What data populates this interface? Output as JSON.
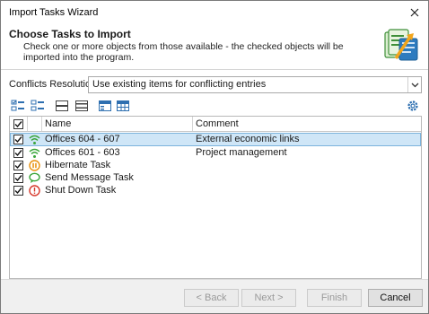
{
  "window": {
    "title": "Import Tasks Wizard"
  },
  "header": {
    "title": "Choose Tasks to Import",
    "description": "Check one or more objects from those available - the checked objects will be imported into the program."
  },
  "conflicts": {
    "label": "Conflicts Resolution:",
    "value": "Use existing items for conflicting entries"
  },
  "grid": {
    "columns": {
      "name": "Name",
      "comment": "Comment"
    },
    "rows": [
      {
        "name": "Offices 604 - 607",
        "comment": "External economic links",
        "icon": "wifi-icon",
        "checked": true,
        "selected": true
      },
      {
        "name": "Offices 601 - 603",
        "comment": "Project management",
        "icon": "wifi-icon",
        "checked": true,
        "selected": false
      },
      {
        "name": "Hibernate Task",
        "comment": "",
        "icon": "pause-icon",
        "checked": true,
        "selected": false
      },
      {
        "name": "Send Message Task",
        "comment": "",
        "icon": "message-icon",
        "checked": true,
        "selected": false
      },
      {
        "name": "Shut Down Task",
        "comment": "",
        "icon": "shutdown-icon",
        "checked": true,
        "selected": false
      }
    ]
  },
  "footer": {
    "back": "< Back",
    "next": "Next >",
    "finish": "Finish",
    "cancel": "Cancel"
  },
  "colors": {
    "selection": "#cfe6f7",
    "accent_green": "#3aa53a",
    "accent_orange": "#e8900c",
    "accent_red": "#d6372a"
  }
}
